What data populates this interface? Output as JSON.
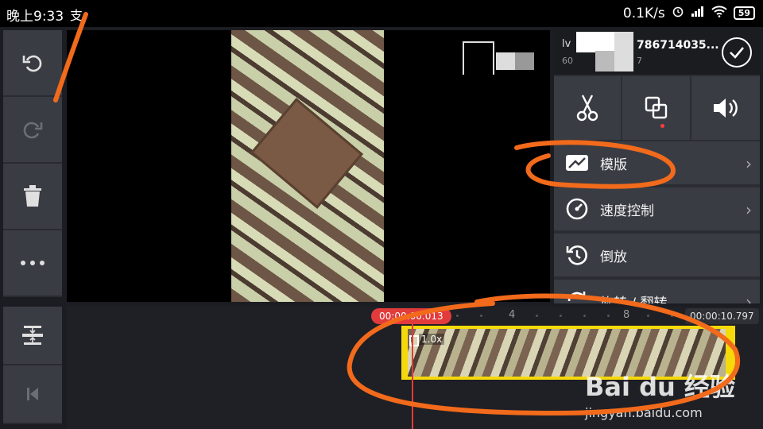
{
  "status_bar": {
    "time": "晚上9:33",
    "notification": "支",
    "net_speed": "0.1K/s",
    "battery": "59"
  },
  "left_toolbar": {
    "undo_icon": "undo-icon",
    "redo_icon": "redo-icon",
    "delete_icon": "trash-icon",
    "more_icon": "more-icon",
    "align_icon": "timeline-fit-icon",
    "jump_start_icon": "skip-start-icon"
  },
  "clip_info": {
    "prefix": "lv",
    "prefix_sub": "60",
    "name": "786714035...",
    "sub": "7"
  },
  "tools": {
    "trim_icon": "scissors-icon",
    "layer_icon": "layer-icon",
    "volume_icon": "volume-icon"
  },
  "menu": [
    {
      "label": "模版",
      "icon": "template-icon"
    },
    {
      "label": "速度控制",
      "icon": "speedometer-icon"
    },
    {
      "label": "倒放",
      "icon": "reverse-icon"
    },
    {
      "label": "旋转 / 翻转",
      "icon": "rotate-icon"
    }
  ],
  "timeline": {
    "current_time": "00:00:00.013",
    "total_time": "00:00:10.797",
    "ruler_labels": [
      "4",
      "8"
    ],
    "clip_speed": "1.0x"
  },
  "watermark": {
    "brand": "Bai du 经验",
    "url": "jingyan.baidu.com"
  },
  "colors": {
    "accent_red": "#e23b3b",
    "clip_yellow": "#f5d90a",
    "annotation_orange": "#f26a1b"
  }
}
